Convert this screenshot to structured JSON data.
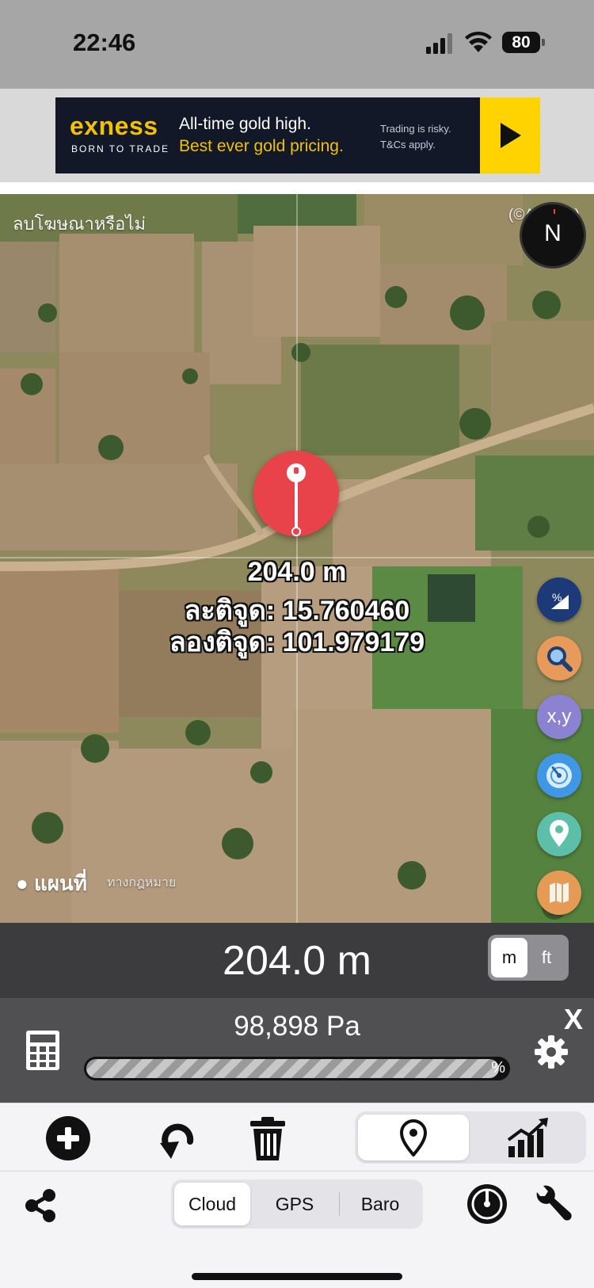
{
  "status_bar": {
    "time": "22:46",
    "battery": "80"
  },
  "ad": {
    "brand": "exness",
    "tagline": "BORN TO TRADE",
    "line1": "All-time gold high.",
    "line2": "Best ever gold pricing.",
    "risk1": "Trading is risky.",
    "risk2": "T&Cs apply."
  },
  "map": {
    "remove_ads": "ลบโฆษณาหรือไม่",
    "attribution": "(©ASTER)",
    "compass_label": "N",
    "pin": {
      "altitude": "204.0 m",
      "latitude": "ละติจูด: 15.760460",
      "longitude": "ลองติจูด: 101.979179"
    },
    "xy_label": "x,y",
    "maps_logo": "แผนที่",
    "legal": "ทางกฎหมาย",
    "fab_icons": [
      "percent-slope-icon",
      "search-icon",
      "xy-icon",
      "radar-icon",
      "location-pin-icon",
      "map-icon"
    ]
  },
  "altitude_bar": {
    "value": "204.0 m",
    "unit_m": "m",
    "unit_ft": "ft",
    "selected_unit": "m"
  },
  "pressure": {
    "value": "98,898 Pa",
    "progress_label": "%",
    "progress_fraction": 0.98,
    "close_label": "X"
  },
  "toolbar": {
    "icons": [
      "add-icon",
      "undo-icon",
      "trash-icon",
      "map-pin-icon",
      "chart-icon"
    ],
    "selected_mode": "map-pin"
  },
  "bottom": {
    "sources": [
      "Cloud",
      "GPS",
      "Baro"
    ],
    "selected_source": "Cloud",
    "icons": [
      "share-icon",
      "gauge-icon",
      "wrench-icon"
    ]
  },
  "colors": {
    "pin_red": "#e8434a",
    "ad_yellow": "#ffd300",
    "ad_brand_gold": "#f2c200",
    "altitude_bar": "#3c3c3e",
    "pressure_panel": "#505053"
  }
}
